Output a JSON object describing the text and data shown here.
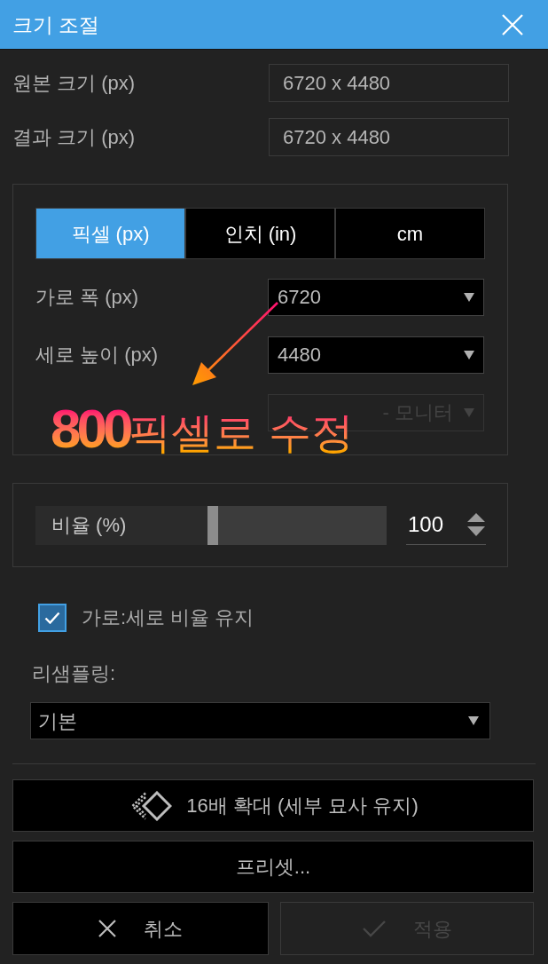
{
  "window": {
    "title": "크기 조절"
  },
  "size_info": [
    {
      "label": "원본 크기 (px)",
      "value": "6720 x 4480"
    },
    {
      "label": "결과 크기 (px)",
      "value": "6720 x 4480"
    }
  ],
  "unit_tabs": [
    {
      "label": "픽셀 (px)",
      "selected": true
    },
    {
      "label": "인치 (in)",
      "selected": false
    },
    {
      "label": "cm",
      "selected": false
    }
  ],
  "dimension_fields": [
    {
      "label": "가로 폭 (px)",
      "value": "6720",
      "disabled": false
    },
    {
      "label": "세로 높이 (px)",
      "value": "4480",
      "disabled": false
    },
    {
      "value": "- 모니터",
      "disabled": true
    }
  ],
  "annotation": {
    "text": "**800**픽셀로 수정"
  },
  "scale": {
    "label": "비율 (%)",
    "level": 0.505,
    "value": "100"
  },
  "keep_aspect": {
    "label": "가로:세로 비율 유지",
    "checked": true
  },
  "resampling": {
    "label": "리샘플링:",
    "value": "기본"
  },
  "buttons": [
    {
      "kind": "upscale",
      "label": "16배 확대 (세부 묘사 유지)",
      "disabled": false
    },
    {
      "kind": "preset",
      "label": "프리셋...",
      "disabled": false
    },
    {
      "kind": "cancel",
      "label": "취소",
      "disabled": false
    },
    {
      "kind": "apply",
      "label": "적용",
      "disabled": true
    }
  ]
}
